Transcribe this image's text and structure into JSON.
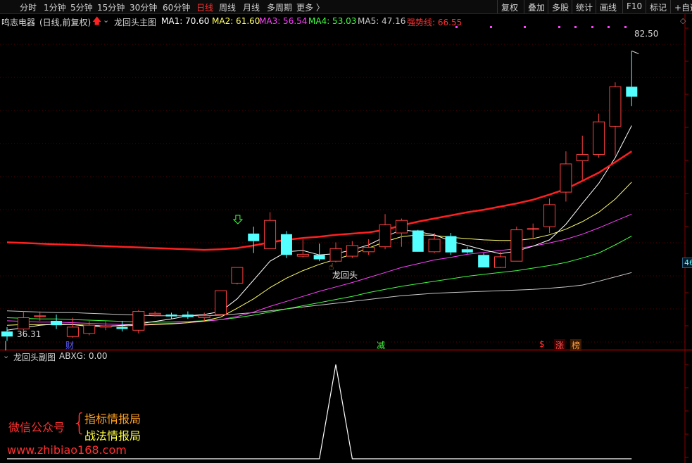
{
  "toolbar": {
    "periods": [
      "分时",
      "1分钟",
      "5分钟",
      "15分钟",
      "30分钟",
      "60分钟",
      "日线",
      "周线",
      "月线",
      "多周期",
      "更多 〉"
    ],
    "active_period": "日线",
    "right_buttons": [
      "复权",
      "叠加",
      "多股",
      "统计",
      "画线",
      "F10",
      "标记",
      "+自选"
    ]
  },
  "main_header": {
    "stock": "鸣志电器",
    "mode": "(日线,前复权)",
    "indicator": "龙回头主图",
    "ma1": "MA1: 70.60",
    "ma2": "MA2: 61.60",
    "ma3": "MA3: 56.54",
    "ma4": "MA4: 53.03",
    "ma5": "MA5: 47.16",
    "strong": "强势线: 66.55"
  },
  "annotations": {
    "high_label": "82.50",
    "low_label": "36.31",
    "signal_label": "龙回头",
    "right_edge_label": "46",
    "bottom_tags": [
      "财",
      "减",
      "$",
      "涨",
      "榜"
    ]
  },
  "sub_header": {
    "indicator": "龙回头副图",
    "value": "ABXG: 0.00"
  },
  "watermark": {
    "left": "微信公众号",
    "line1": "指标情报局",
    "line2": "战法情报局",
    "url": "www.zhibiao168.com"
  },
  "colors": {
    "up": "#ff4040",
    "down": "#54ffff",
    "ma1": "#ffffff",
    "ma2": "#ffff66",
    "ma3": "#ff40ff",
    "ma4": "#40ff40",
    "ma5": "#c8c8c8",
    "strong_line": "#ff2020",
    "grid": "#5a0000"
  },
  "chart_data": {
    "type": "candlestick",
    "price_range": [
      34,
      84
    ],
    "candles": [
      {
        "o": 37.8,
        "c": 37.0,
        "h": 38.5,
        "l": 36.3
      },
      {
        "o": 38.2,
        "c": 40.0,
        "h": 41.0,
        "l": 37.5
      },
      {
        "o": 40.2,
        "c": 40.3,
        "h": 41.0,
        "l": 39.5
      },
      {
        "o": 39.5,
        "c": 38.8,
        "h": 40.5,
        "l": 38.2
      },
      {
        "o": 37.0,
        "c": 38.5,
        "h": 40.0,
        "l": 36.8
      },
      {
        "o": 37.5,
        "c": 38.8,
        "h": 39.5,
        "l": 37.2
      },
      {
        "o": 38.5,
        "c": 38.7,
        "h": 39.5,
        "l": 38.0
      },
      {
        "o": 38.5,
        "c": 38.2,
        "h": 39.5,
        "l": 37.8
      },
      {
        "o": 38.0,
        "c": 41.0,
        "h": 41.2,
        "l": 37.5
      },
      {
        "o": 40.5,
        "c": 40.7,
        "h": 41.0,
        "l": 40.2
      },
      {
        "o": 40.5,
        "c": 40.2,
        "h": 40.8,
        "l": 39.8
      },
      {
        "o": 40.5,
        "c": 40.1,
        "h": 41.0,
        "l": 39.8
      },
      {
        "o": 40.0,
        "c": 40.3,
        "h": 40.8,
        "l": 39.5
      },
      {
        "o": 40.5,
        "c": 44.3,
        "h": 44.3,
        "l": 40.5
      },
      {
        "o": 45.5,
        "c": 48.0,
        "h": 48.0,
        "l": 45.3
      },
      {
        "o": 53.4,
        "c": 52.2,
        "h": 54.5,
        "l": 50.3
      },
      {
        "o": 51.0,
        "c": 55.5,
        "h": 56.8,
        "l": 51.0
      },
      {
        "o": 53.3,
        "c": 50.0,
        "h": 53.8,
        "l": 49.5
      },
      {
        "o": 49.8,
        "c": 50.1,
        "h": 52.5,
        "l": 49.6
      },
      {
        "o": 50.0,
        "c": 49.3,
        "h": 51.8,
        "l": 49.0
      },
      {
        "o": 49.0,
        "c": 51.0,
        "h": 52.0,
        "l": 48.8
      },
      {
        "o": 49.8,
        "c": 51.5,
        "h": 52.2,
        "l": 49.5
      },
      {
        "o": 50.5,
        "c": 51.2,
        "h": 52.5,
        "l": 50.0
      },
      {
        "o": 51.3,
        "c": 54.8,
        "h": 56.5,
        "l": 50.9
      },
      {
        "o": 53.5,
        "c": 55.5,
        "h": 55.8,
        "l": 51.3
      },
      {
        "o": 53.9,
        "c": 50.5,
        "h": 54.0,
        "l": 50.5
      },
      {
        "o": 50.5,
        "c": 52.5,
        "h": 53.5,
        "l": 50.3
      },
      {
        "o": 53.0,
        "c": 50.4,
        "h": 53.5,
        "l": 50.0
      },
      {
        "o": 50.9,
        "c": 50.4,
        "h": 51.3,
        "l": 50.2
      },
      {
        "o": 50.0,
        "c": 48.0,
        "h": 50.3,
        "l": 48.0
      },
      {
        "o": 48.0,
        "c": 49.7,
        "h": 50.5,
        "l": 47.9
      },
      {
        "o": 49.0,
        "c": 54.0,
        "h": 54.5,
        "l": 49.0
      },
      {
        "o": 54.2,
        "c": 54.2,
        "h": 55.0,
        "l": 52.5
      },
      {
        "o": 54.5,
        "c": 58.0,
        "h": 59.0,
        "l": 53.5
      },
      {
        "o": 60.0,
        "c": 64.5,
        "h": 66.5,
        "l": 58.5
      },
      {
        "o": 65.0,
        "c": 66.0,
        "h": 69.0,
        "l": 62.0
      },
      {
        "o": 66.0,
        "c": 71.2,
        "h": 72.5,
        "l": 65.5
      },
      {
        "o": 70.5,
        "c": 76.8,
        "h": 77.5,
        "l": 65.8
      },
      {
        "o": 76.8,
        "c": 75.2,
        "h": 82.5,
        "l": 73.7
      }
    ],
    "ma1": [
      38.0,
      38.4,
      38.8,
      39.0,
      38.9,
      38.6,
      38.6,
      38.8,
      39.0,
      39.4,
      39.8,
      40.3,
      40.5,
      41.0,
      43.0,
      46.0,
      49.0,
      50.5,
      50.7,
      50.0,
      50.2,
      50.8,
      51.6,
      52.9,
      54.0,
      53.7,
      53.2,
      52.2,
      51.5,
      50.8,
      50.2,
      50.6,
      51.4,
      52.4,
      54.9,
      58.2,
      61.4,
      65.5,
      70.6
    ],
    "ma2": [
      38.8,
      38.9,
      38.9,
      38.9,
      38.9,
      38.8,
      38.7,
      38.7,
      38.8,
      38.9,
      39.0,
      39.2,
      39.5,
      40.1,
      41.5,
      43.0,
      44.8,
      46.3,
      47.5,
      48.5,
      49.3,
      50.1,
      51.1,
      52.1,
      52.9,
      53.2,
      53.1,
      52.8,
      52.6,
      52.4,
      52.3,
      52.3,
      52.6,
      53.2,
      54.1,
      55.3,
      56.8,
      58.9,
      61.6
    ],
    "ma3": [
      39.5,
      39.4,
      39.3,
      39.3,
      39.2,
      39.1,
      39.0,
      38.9,
      38.9,
      39.0,
      39.1,
      39.2,
      39.4,
      39.7,
      40.2,
      40.9,
      41.8,
      42.6,
      43.4,
      44.2,
      44.9,
      45.6,
      46.4,
      47.2,
      48.0,
      48.6,
      49.2,
      49.6,
      50.1,
      50.4,
      50.7,
      51.0,
      51.4,
      51.9,
      52.5,
      53.3,
      54.3,
      55.4,
      56.5
    ],
    "ma4": [
      40.0,
      39.9,
      39.8,
      39.8,
      39.7,
      39.6,
      39.5,
      39.4,
      39.3,
      39.3,
      39.3,
      39.4,
      39.5,
      39.7,
      40.0,
      40.4,
      40.9,
      41.4,
      41.9,
      42.4,
      42.9,
      43.4,
      44.0,
      44.5,
      45.0,
      45.4,
      45.8,
      46.2,
      46.6,
      46.9,
      47.2,
      47.5,
      47.9,
      48.3,
      48.8,
      49.5,
      50.3,
      51.6,
      53.0
    ],
    "ma5": [
      41.1,
      41.0,
      40.9,
      40.8,
      40.8,
      40.7,
      40.6,
      40.5,
      40.4,
      40.3,
      40.3,
      40.3,
      40.3,
      40.4,
      40.6,
      40.8,
      41.1,
      41.4,
      41.7,
      42.0,
      42.3,
      42.6,
      42.9,
      43.2,
      43.5,
      43.7,
      43.9,
      44.0,
      44.1,
      44.2,
      44.3,
      44.4,
      44.5,
      44.7,
      44.9,
      45.2,
      45.8,
      46.5,
      47.2
    ],
    "strong": [
      52.0,
      51.9,
      51.8,
      51.7,
      51.6,
      51.5,
      51.4,
      51.3,
      51.2,
      51.1,
      51.0,
      50.9,
      50.8,
      50.9,
      51.1,
      51.5,
      52.0,
      52.4,
      52.7,
      52.9,
      53.2,
      53.4,
      53.6,
      54.0,
      54.7,
      55.3,
      55.8,
      56.3,
      56.8,
      57.2,
      57.7,
      58.2,
      58.8,
      59.6,
      60.5,
      61.8,
      63.1,
      64.8,
      66.5
    ],
    "sub_abxg": [
      0,
      0,
      0,
      0,
      0,
      0,
      0,
      0,
      0,
      0,
      0,
      0,
      0,
      0,
      0,
      0,
      0,
      0,
      0,
      0,
      1,
      0,
      0,
      0,
      0,
      0,
      0,
      0,
      0,
      0,
      0,
      0,
      0,
      0,
      0,
      0,
      0,
      0,
      0
    ]
  }
}
